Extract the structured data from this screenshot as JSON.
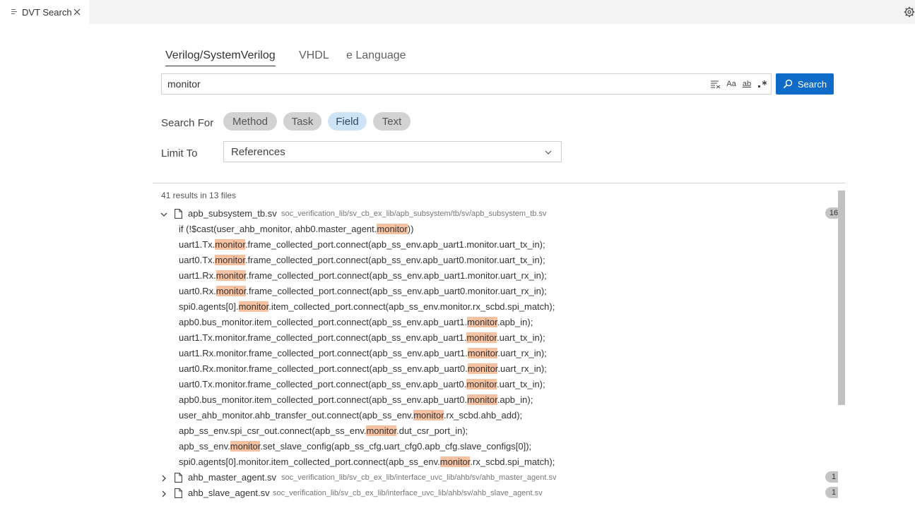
{
  "tab": {
    "title": "DVT Search"
  },
  "language_tabs": [
    {
      "label": "Verilog/SystemVerilog",
      "active": true
    },
    {
      "label": "VHDL",
      "active": false
    },
    {
      "label": "e Language",
      "active": false
    }
  ],
  "search": {
    "value": "monitor",
    "options": [
      "Aa",
      "ab"
    ],
    "button_label": "Search"
  },
  "search_for": {
    "label": "Search For",
    "chips": [
      {
        "label": "Method",
        "active": false
      },
      {
        "label": "Task",
        "active": false
      },
      {
        "label": "Field",
        "active": true
      },
      {
        "label": "Text",
        "active": false
      }
    ]
  },
  "limit_to": {
    "label": "Limit To",
    "value": "References"
  },
  "summary": "41 results in 13 files",
  "colors": {
    "accent": "#0e6cc8",
    "highlight": "#f7c2a2",
    "chip_active": "#cfe3f7"
  },
  "files": [
    {
      "name": "apb_subsystem_tb.sv",
      "path": "soc_verification_lib/sv_cb_ex_lib/apb_subsystem/tb/sv/apb_subsystem_tb.sv",
      "count": "16",
      "expanded": true,
      "matches": [
        {
          "pre": "if (!$cast(user_ahb_monitor, ahb0.master_agent.",
          "hit": "monitor",
          "post": "))"
        },
        {
          "pre": "uart1.Tx.",
          "hit": "monitor",
          "post": ".frame_collected_port.connect(apb_ss_env.apb_uart1.monitor.uart_tx_in);"
        },
        {
          "pre": "uart0.Tx.",
          "hit": "monitor",
          "post": ".frame_collected_port.connect(apb_ss_env.apb_uart0.monitor.uart_tx_in);"
        },
        {
          "pre": "uart1.Rx.",
          "hit": "monitor",
          "post": ".frame_collected_port.connect(apb_ss_env.apb_uart1.monitor.uart_rx_in);"
        },
        {
          "pre": "uart0.Rx.",
          "hit": "monitor",
          "post": ".frame_collected_port.connect(apb_ss_env.apb_uart0.monitor.uart_rx_in);"
        },
        {
          "pre": "spi0.agents[0].",
          "hit": "monitor",
          "post": ".item_collected_port.connect(apb_ss_env.monitor.rx_scbd.spi_match);"
        },
        {
          "pre": "apb0.bus_monitor.item_collected_port.connect(apb_ss_env.apb_uart1.",
          "hit": "monitor",
          "post": ".apb_in);"
        },
        {
          "pre": "uart1.Tx.monitor.frame_collected_port.connect(apb_ss_env.apb_uart1.",
          "hit": "monitor",
          "post": ".uart_tx_in);"
        },
        {
          "pre": "uart1.Rx.monitor.frame_collected_port.connect(apb_ss_env.apb_uart1.",
          "hit": "monitor",
          "post": ".uart_rx_in);"
        },
        {
          "pre": "uart0.Rx.monitor.frame_collected_port.connect(apb_ss_env.apb_uart0.",
          "hit": "monitor",
          "post": ".uart_rx_in);"
        },
        {
          "pre": "uart0.Tx.monitor.frame_collected_port.connect(apb_ss_env.apb_uart0.",
          "hit": "monitor",
          "post": ".uart_tx_in);"
        },
        {
          "pre": "apb0.bus_monitor.item_collected_port.connect(apb_ss_env.apb_uart0.",
          "hit": "monitor",
          "post": ".apb_in);"
        },
        {
          "pre": "user_ahb_monitor.ahb_transfer_out.connect(apb_ss_env.",
          "hit": "monitor",
          "post": ".rx_scbd.ahb_add);"
        },
        {
          "pre": "apb_ss_env.spi_csr_out.connect(apb_ss_env.",
          "hit": "monitor",
          "post": ".dut_csr_port_in);"
        },
        {
          "pre": "apb_ss_env.",
          "hit": "monitor",
          "post": ".set_slave_config(apb_ss_cfg.uart_cfg0.apb_cfg.slave_configs[0]);"
        },
        {
          "pre": "spi0.agents[0].monitor.item_collected_port.connect(apb_ss_env.",
          "hit": "monitor",
          "post": ".rx_scbd.spi_match);"
        }
      ]
    },
    {
      "name": "ahb_master_agent.sv",
      "path": "soc_verification_lib/sv_cb_ex_lib/interface_uvc_lib/ahb/sv/ahb_master_agent.sv",
      "count": "1",
      "expanded": false,
      "matches": []
    },
    {
      "name": "ahb_slave_agent.sv",
      "path": "soc_verification_lib/sv_cb_ex_lib/interface_uvc_lib/ahb/sv/ahb_slave_agent.sv",
      "count": "1",
      "expanded": false,
      "matches": []
    }
  ]
}
